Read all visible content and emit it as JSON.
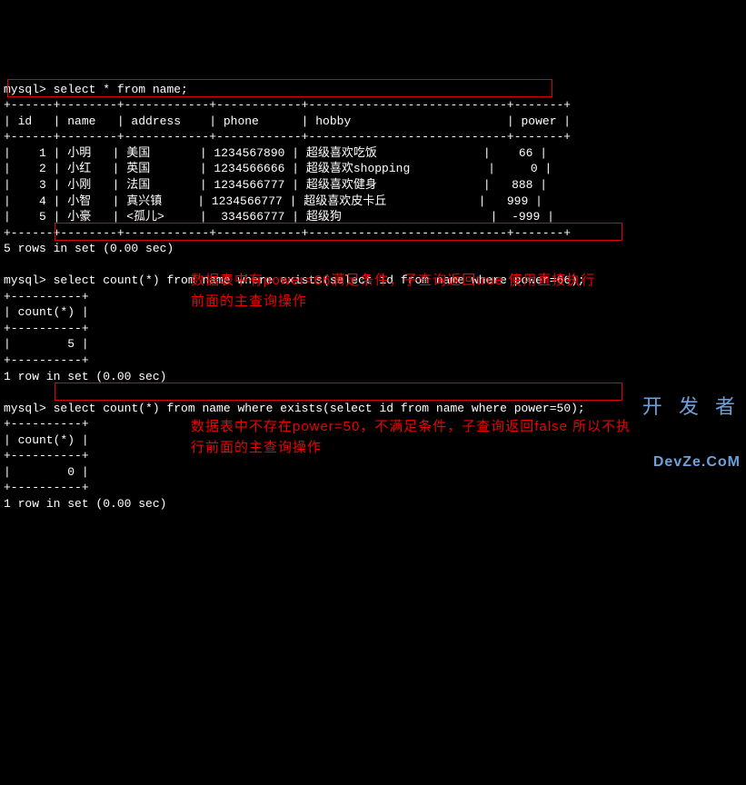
{
  "query1": {
    "prompt": "mysql>",
    "sql": "select * from name;",
    "border_top": "+------+--------+------------+------------+----------------------------+-------+",
    "header": "| id   | name   | address    | phone      | hobby                      | power |",
    "rows": [
      "|    1 | 小明   | 美国       | 1234567890 | 超级喜欢吃饭               |    66 |",
      "|    2 | 小红   | 英国       | 1234566666 | 超级喜欢shopping           |     0 |",
      "|    3 | 小刚   | 法国       | 1234566777 | 超级喜欢健身               |   888 |",
      "|    4 | 小智   | 真兴镇     | 1234566777 | 超级喜欢皮卡丘             |   999 |",
      "|    5 | 小豪   | <孤儿>     |  334566777 | 超级狗                     |  -999 |"
    ],
    "footer": "5 rows in set (0.00 sec)"
  },
  "query2": {
    "prompt": "mysql>",
    "sql": "select count(*) from name where exists(select id from name where power=66);",
    "border": "+----------+",
    "header": "| count(*) |",
    "row": "|        5 |",
    "footer": "1 row in set (0.00 sec)",
    "annotation": "数据表中有power=66满足条件，子查询返回true\n使用直接执行前面的主查询操作"
  },
  "query3": {
    "prompt": "mysql>",
    "sql": "select count(*) from name where exists(select id from name where power=50);",
    "border": "+----------+",
    "header": "| count(*) |",
    "row": "|        0 |",
    "footer": "1 row in set (0.00 sec)",
    "annotation": "数据表中不存在power=50，不满足条件，子查询返回false\n所以不执行前面的主查询操作"
  },
  "watermark": {
    "line1": "开 发 者",
    "line2": "DevZe.CoM"
  },
  "chart_data": {
    "type": "table",
    "columns": [
      "id",
      "name",
      "address",
      "phone",
      "hobby",
      "power"
    ],
    "rows": [
      {
        "id": 1,
        "name": "小明",
        "address": "美国",
        "phone": "1234567890",
        "hobby": "超级喜欢吃饭",
        "power": 66
      },
      {
        "id": 2,
        "name": "小红",
        "address": "英国",
        "phone": "1234566666",
        "hobby": "超级喜欢shopping",
        "power": 0
      },
      {
        "id": 3,
        "name": "小刚",
        "address": "法国",
        "phone": "1234566777",
        "hobby": "超级喜欢健身",
        "power": 888
      },
      {
        "id": 4,
        "name": "小智",
        "address": "真兴镇",
        "phone": "1234566777",
        "hobby": "超级喜欢皮卡丘",
        "power": 999
      },
      {
        "id": 5,
        "name": "小豪",
        "address": "<孤儿>",
        "phone": "334566777",
        "hobby": "超级狗",
        "power": -999
      }
    ],
    "count_power66": 5,
    "count_power50": 0
  }
}
